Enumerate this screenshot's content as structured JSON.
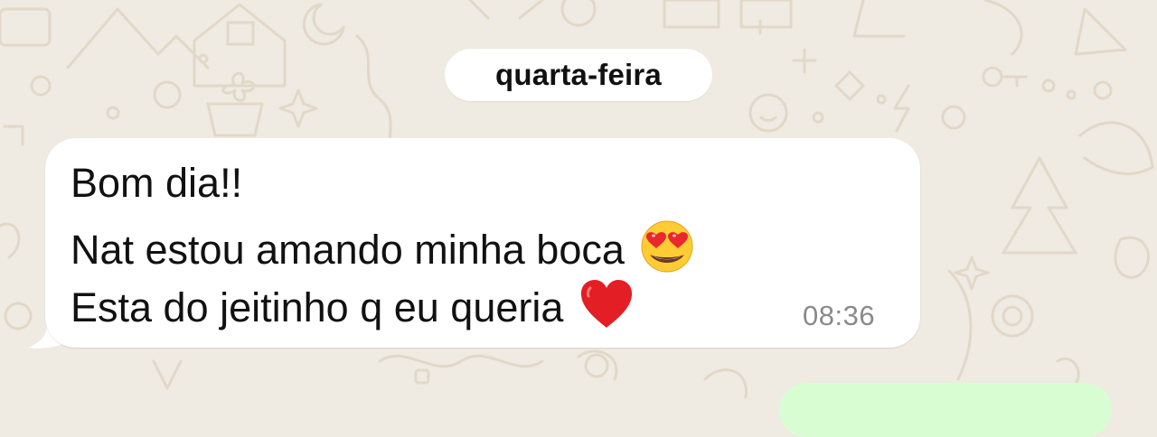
{
  "chat": {
    "date_separator": "quarta-feira",
    "incoming_message": {
      "lines": [
        "Bom dia!!",
        "Nat estou amando minha boca",
        "Esta do jeitinho q eu queria"
      ],
      "emojis": [
        "heart-eyes-emoji",
        "red-heart-emoji"
      ],
      "time": "08:36"
    }
  },
  "colors": {
    "wallpaper": "#efeae2",
    "incoming_bubble": "#ffffff",
    "outgoing_bubble": "#d9fdd3",
    "timestamp_text": "#8a8a8a"
  }
}
